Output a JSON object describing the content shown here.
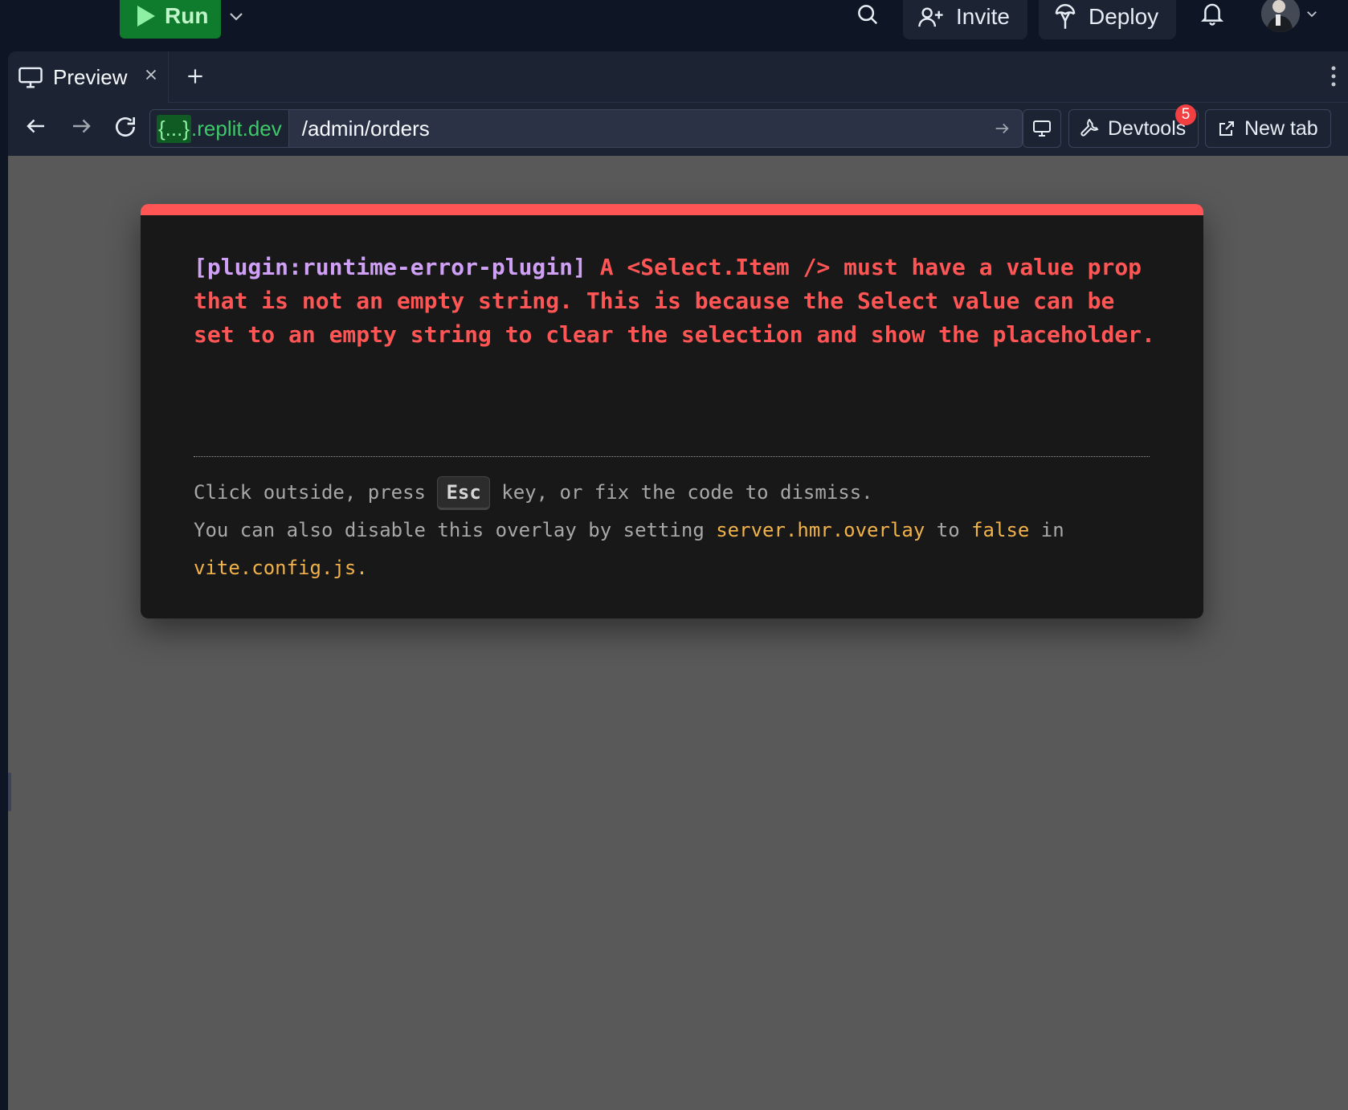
{
  "topbar": {
    "run_label": "Run",
    "invite_label": "Invite",
    "deploy_label": "Deploy"
  },
  "tab": {
    "label": "Preview"
  },
  "url": {
    "domain_mask": "{...}",
    "domain_suffix": ".replit.dev",
    "path": "/admin/orders"
  },
  "tools": {
    "devtools_label": "Devtools",
    "devtools_badge": "5",
    "newtab_label": "New tab"
  },
  "error": {
    "plugin": "[plugin:runtime-error-plugin]",
    "message": " A <Select.Item /> must have a value prop that is not an empty string. This is because the Select value can be set to an empty string to clear the selection and show the placeholder.",
    "tip1_pre": "Click outside, press ",
    "tip1_key": "Esc",
    "tip1_post": " key, or fix the code to dismiss.",
    "tip2_pre": "You can also disable this overlay by setting ",
    "tip2_code1": "server.hmr.overlay",
    "tip2_mid": " to ",
    "tip2_code2": "false",
    "tip2_post": " in",
    "tip3_code": "vite.config.js",
    "tip3_post": "."
  },
  "colors": {
    "accent_red": "#ff5555",
    "run_green": "#0f7b2c",
    "plugin_purple": "#cfa0f5",
    "code_orange": "#f2b24a"
  }
}
